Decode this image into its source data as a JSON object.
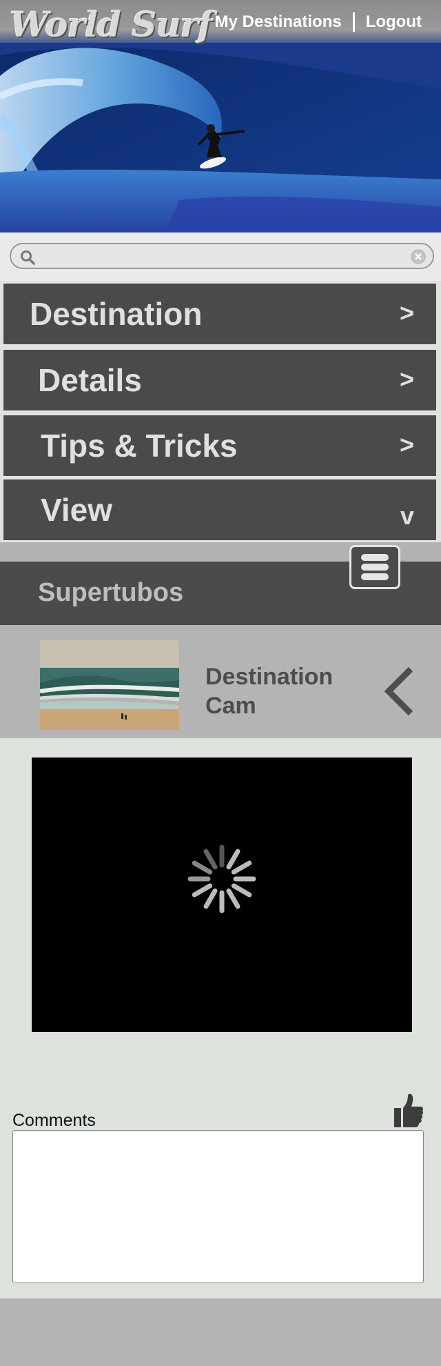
{
  "header": {
    "logo_text": "World Surf",
    "nav": [
      {
        "label": "My Destinations"
      },
      {
        "label": "Logout"
      }
    ]
  },
  "search": {
    "placeholder": "",
    "value": ""
  },
  "menu": {
    "items": [
      {
        "label": "Destination",
        "chevron": ">"
      },
      {
        "label": "Details",
        "chevron": ">"
      },
      {
        "label": "Tips & Tricks",
        "chevron": ">"
      },
      {
        "label": "View",
        "chevron": "v"
      }
    ]
  },
  "spot": {
    "name": "Supertubos"
  },
  "cam": {
    "label": "Destination Cam"
  },
  "video": {
    "state": "loading"
  },
  "comments": {
    "label": "Comments",
    "value": ""
  },
  "icons": {
    "search": "search-icon",
    "clear": "clear-icon",
    "menu": "hamburger-icon",
    "back": "chevron-left-icon",
    "like": "thumbs-up-icon",
    "spinner": "loading-spinner-icon"
  },
  "colors": {
    "menu_bg": "#4a4a4a",
    "menu_text": "#e0e0e0",
    "panel_bg": "#b4b4b4",
    "page_bg": "#dde2dc"
  }
}
